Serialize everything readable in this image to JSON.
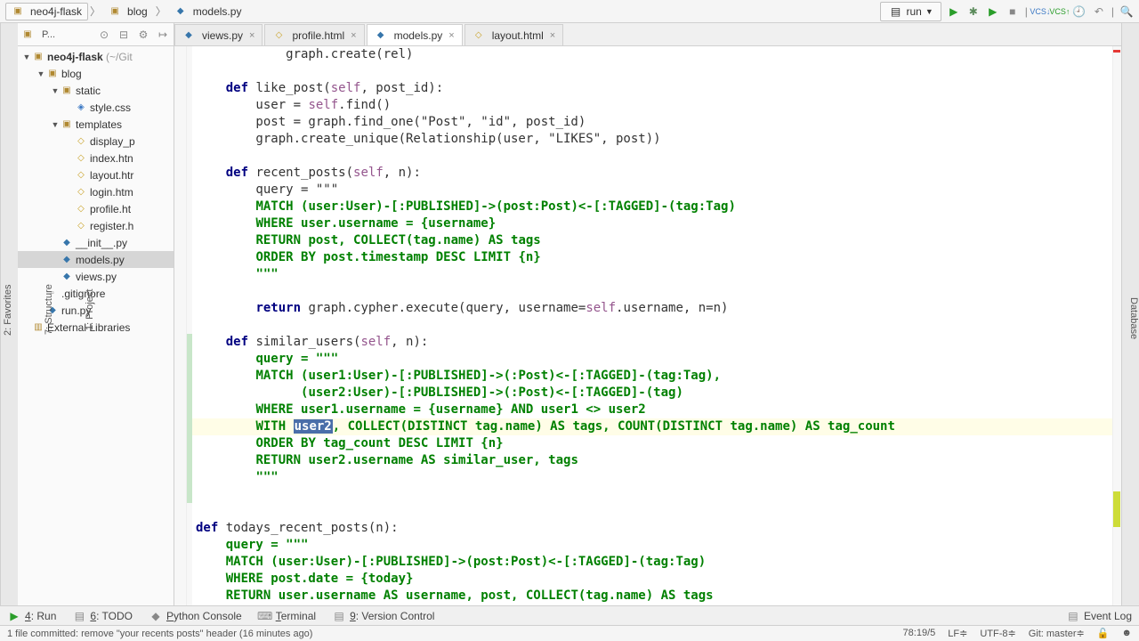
{
  "breadcrumb": {
    "items": [
      "neo4j-flask",
      "blog",
      "models.py"
    ]
  },
  "toolbar": {
    "run_config": "run",
    "icons": [
      "play",
      "debug",
      "run-coverage",
      "stop",
      "vcs-update",
      "vcs-commit",
      "vcs-history",
      "undo",
      "search"
    ]
  },
  "sidebar": {
    "view_label": "P...",
    "project_root": {
      "name": "neo4j-flask",
      "hint": "(~/Git"
    },
    "tree": [
      {
        "d": 1,
        "exp": true,
        "type": "folder",
        "name": "blog"
      },
      {
        "d": 2,
        "exp": true,
        "type": "folder",
        "name": "static"
      },
      {
        "d": 3,
        "type": "css",
        "name": "style.css"
      },
      {
        "d": 2,
        "exp": true,
        "type": "folder",
        "name": "templates"
      },
      {
        "d": 3,
        "type": "html",
        "name": "display_p"
      },
      {
        "d": 3,
        "type": "html",
        "name": "index.htn"
      },
      {
        "d": 3,
        "type": "html",
        "name": "layout.htr"
      },
      {
        "d": 3,
        "type": "html",
        "name": "login.htm"
      },
      {
        "d": 3,
        "type": "html",
        "name": "profile.ht"
      },
      {
        "d": 3,
        "type": "html",
        "name": "register.h"
      },
      {
        "d": 2,
        "type": "py",
        "name": "__init__.py"
      },
      {
        "d": 2,
        "type": "py",
        "name": "models.py",
        "sel": true
      },
      {
        "d": 2,
        "type": "py",
        "name": "views.py"
      },
      {
        "d": 1,
        "type": "file",
        "name": ".gitignore"
      },
      {
        "d": 1,
        "type": "py",
        "name": "run.py"
      },
      {
        "d": 0,
        "type": "lib",
        "name": "External Libraries"
      }
    ]
  },
  "tabs": [
    {
      "type": "py",
      "label": "views.py",
      "active": false
    },
    {
      "type": "html",
      "label": "profile.html",
      "active": false
    },
    {
      "type": "py",
      "label": "models.py",
      "active": true
    },
    {
      "type": "html",
      "label": "layout.html",
      "active": false
    }
  ],
  "left_tool_tabs": [
    "1: Project",
    "7: Structure",
    "2: Favorites"
  ],
  "right_tool_tabs": [
    "Database"
  ],
  "code": {
    "highlighted_line_index": 22,
    "selected_word": "user2",
    "lines": [
      {
        "t": "            graph.create(rel)",
        "chg": ""
      },
      {
        "t": "",
        "chg": ""
      },
      {
        "t": "    def like_post(self, post_id):",
        "chg": ""
      },
      {
        "t": "        user = self.find()",
        "chg": ""
      },
      {
        "t": "        post = graph.find_one(\"Post\", \"id\", post_id)",
        "chg": ""
      },
      {
        "t": "        graph.create_unique(Relationship(user, \"LIKES\", post))",
        "chg": ""
      },
      {
        "t": "",
        "chg": ""
      },
      {
        "t": "    def recent_posts(self, n):",
        "chg": ""
      },
      {
        "t": "        query = \"\"\"",
        "chg": ""
      },
      {
        "t": "        MATCH (user:User)-[:PUBLISHED]->(post:Post)<-[:TAGGED]-(tag:Tag)",
        "chg": ""
      },
      {
        "t": "        WHERE user.username = {username}",
        "chg": ""
      },
      {
        "t": "        RETURN post, COLLECT(tag.name) AS tags",
        "chg": ""
      },
      {
        "t": "        ORDER BY post.timestamp DESC LIMIT {n}",
        "chg": ""
      },
      {
        "t": "        \"\"\"",
        "chg": ""
      },
      {
        "t": "",
        "chg": ""
      },
      {
        "t": "        return graph.cypher.execute(query, username=self.username, n=n)",
        "chg": ""
      },
      {
        "t": "",
        "chg": ""
      },
      {
        "t": "    def similar_users(self, n):",
        "chg": "green"
      },
      {
        "t": "        query = \"\"\"",
        "chg": "green"
      },
      {
        "t": "        MATCH (user1:User)-[:PUBLISHED]->(:Post)<-[:TAGGED]-(tag:Tag),",
        "chg": "green"
      },
      {
        "t": "              (user2:User)-[:PUBLISHED]->(:Post)<-[:TAGGED]-(tag)",
        "chg": "green"
      },
      {
        "t": "        WHERE user1.username = {username} AND user1 <> user2",
        "chg": "green"
      },
      {
        "t": "        WITH user2, COLLECT(DISTINCT tag.name) AS tags, COUNT(DISTINCT tag.name) AS tag_count",
        "chg": "green"
      },
      {
        "t": "        ORDER BY tag_count DESC LIMIT {n}",
        "chg": "green"
      },
      {
        "t": "        RETURN user2.username AS similar_user, tags",
        "chg": "green"
      },
      {
        "t": "        \"\"\"",
        "chg": "green"
      },
      {
        "t": "",
        "chg": "green"
      },
      {
        "t": "",
        "chg": ""
      },
      {
        "t": "def todays_recent_posts(n):",
        "chg": ""
      },
      {
        "t": "    query = \"\"\"",
        "chg": ""
      },
      {
        "t": "    MATCH (user:User)-[:PUBLISHED]->(post:Post)<-[:TAGGED]-(tag:Tag)",
        "chg": ""
      },
      {
        "t": "    WHERE post.date = {today}",
        "chg": ""
      },
      {
        "t": "    RETURN user.username AS username, post, COLLECT(tag.name) AS tags",
        "chg": ""
      }
    ]
  },
  "bottom_tabs": [
    {
      "icon": "play",
      "label": "4: Run",
      "u": "4"
    },
    {
      "icon": "todo",
      "label": "6: TODO",
      "u": "6"
    },
    {
      "icon": "py",
      "label": "Python Console",
      "u": "P"
    },
    {
      "icon": "term",
      "label": "Terminal",
      "u": "T"
    },
    {
      "icon": "vcs",
      "label": "9: Version Control",
      "u": "9"
    }
  ],
  "bottom_right": "Event Log",
  "status": {
    "msg": "1 file committed: remove \"your recents posts\" header (16 minutes ago)",
    "pos": "78:19/5",
    "le": "LF≑",
    "enc": "UTF-8≑",
    "git": "Git: master≑",
    "lock": "🔓"
  }
}
